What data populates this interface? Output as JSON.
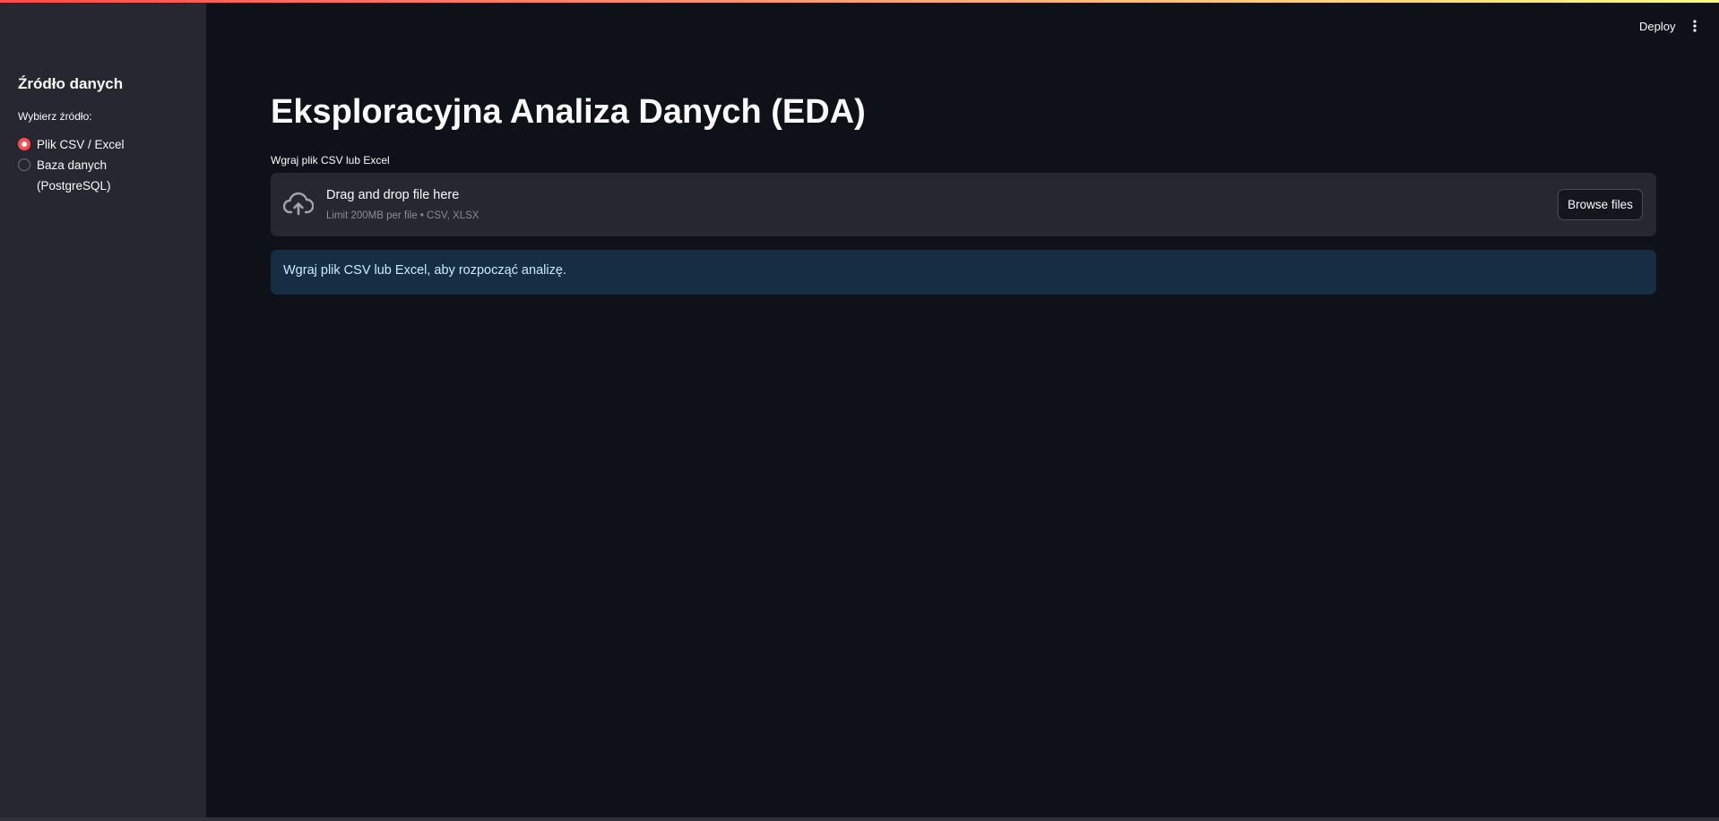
{
  "header": {
    "deploy_label": "Deploy",
    "menu_icon": "kebab-menu-icon"
  },
  "sidebar": {
    "title": "Źródło danych",
    "source_label": "Wybierz źródło:",
    "options": [
      {
        "label": "Plik CSV / Excel",
        "selected": true
      },
      {
        "label": "Baza danych (PostgreSQL)",
        "selected": false
      }
    ]
  },
  "main": {
    "title": "Eksploracyjna Analiza Danych (EDA)",
    "uploader": {
      "label": "Wgraj plik CSV lub Excel",
      "icon": "cloud-upload-icon",
      "drop_title": "Drag and drop file here",
      "limit_text": "Limit 200MB per file • CSV, XLSX",
      "browse_label": "Browse files"
    },
    "info_message": "Wgraj plik CSV lub Excel, aby rozpocząć analizę."
  },
  "colors": {
    "accent": "#ff4b4b",
    "background": "#0e1117",
    "sidebar": "#262730",
    "info_background": "#172d43",
    "info_text": "#c7ebff"
  }
}
